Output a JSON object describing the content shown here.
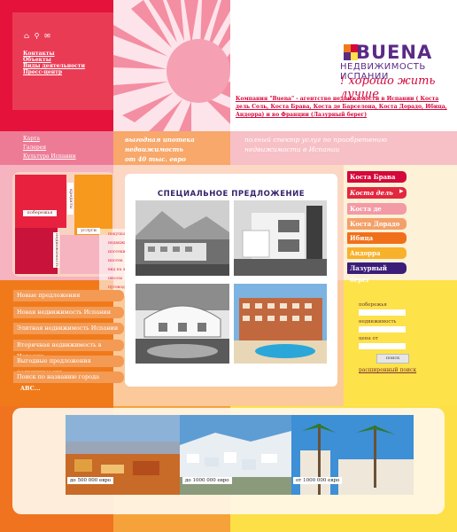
{
  "header": {
    "top_nav": [
      "Контакты",
      "Объекты",
      "Виды деятельности",
      "Пресс-центр"
    ],
    "brand": "BUENA",
    "brand_sub": "НЕДВИЖИМОСТЬ ИСПАНИИ",
    "slogan": "! хорошо жить лучше",
    "company_text": "Компания \"Buena\" - агентство недвижимости в Испании ( Коста дель Соль, Коста Брава, Коста де Барселона, Коста Дорадо, Ибица, Андорра) и во Франции (Лазурный берег)"
  },
  "band": {
    "links": [
      "Карта",
      "Галерея",
      "Культура Испании"
    ],
    "promo": [
      "выгодная ипотека",
      "недвижимость",
      "от 40 тыс. евро"
    ],
    "promo2": "полный спектр услуг по приобретению недвижимости в Испании"
  },
  "side_block": {
    "tab1": "кредиты",
    "tab2": "поберeжья",
    "tab3": "услуги",
    "tab4": "недвижимость",
    "lines": [
      "покупка недвижимости",
      "ипотеки и виды ипотек",
      "вид на жительство",
      "школы",
      "путеводители"
    ]
  },
  "left_menu": [
    "Новые предложения",
    "Новая недвижимость Испании",
    "Элитная недвижимость Испании",
    "Вторичная недвижимость в Испании",
    "Выгодные предложения недвижимости",
    "Поиск по названию города"
  ],
  "left_menu_suffix": "ABC...",
  "special": {
    "title": "СПЕЦИАЛЬНОЕ ПРЕДЛОЖЕНИЕ"
  },
  "regions": [
    {
      "label": "Коста Брава",
      "color": "#d4083a"
    },
    {
      "label": "Коста дель соль",
      "color": "#e2283f"
    },
    {
      "label": "Коста де Барселона",
      "color": "#f29aa6"
    },
    {
      "label": "Коста Дорадо",
      "color": "#f3a16a"
    },
    {
      "label": "Ибица",
      "color": "#f0701a"
    },
    {
      "label": "Андорра",
      "color": "#f7b12a"
    },
    {
      "label": "Лазурный берег",
      "color": "#3b1d79"
    }
  ],
  "search": {
    "label1": "побережья",
    "label2": "недвижимость",
    "label3": "цена от",
    "button": "поиск",
    "advanced": "расширенный поиск"
  },
  "strip": {
    "prices": [
      "до 500 000 евро",
      "до 1000 000 евро",
      "от 1000 000 евро"
    ]
  },
  "colors": {
    "red": "#d4083a",
    "orange": "#f07a1a",
    "yellow": "#fde24a",
    "pink": "#f6b3c0",
    "purple": "#5b2a87"
  }
}
